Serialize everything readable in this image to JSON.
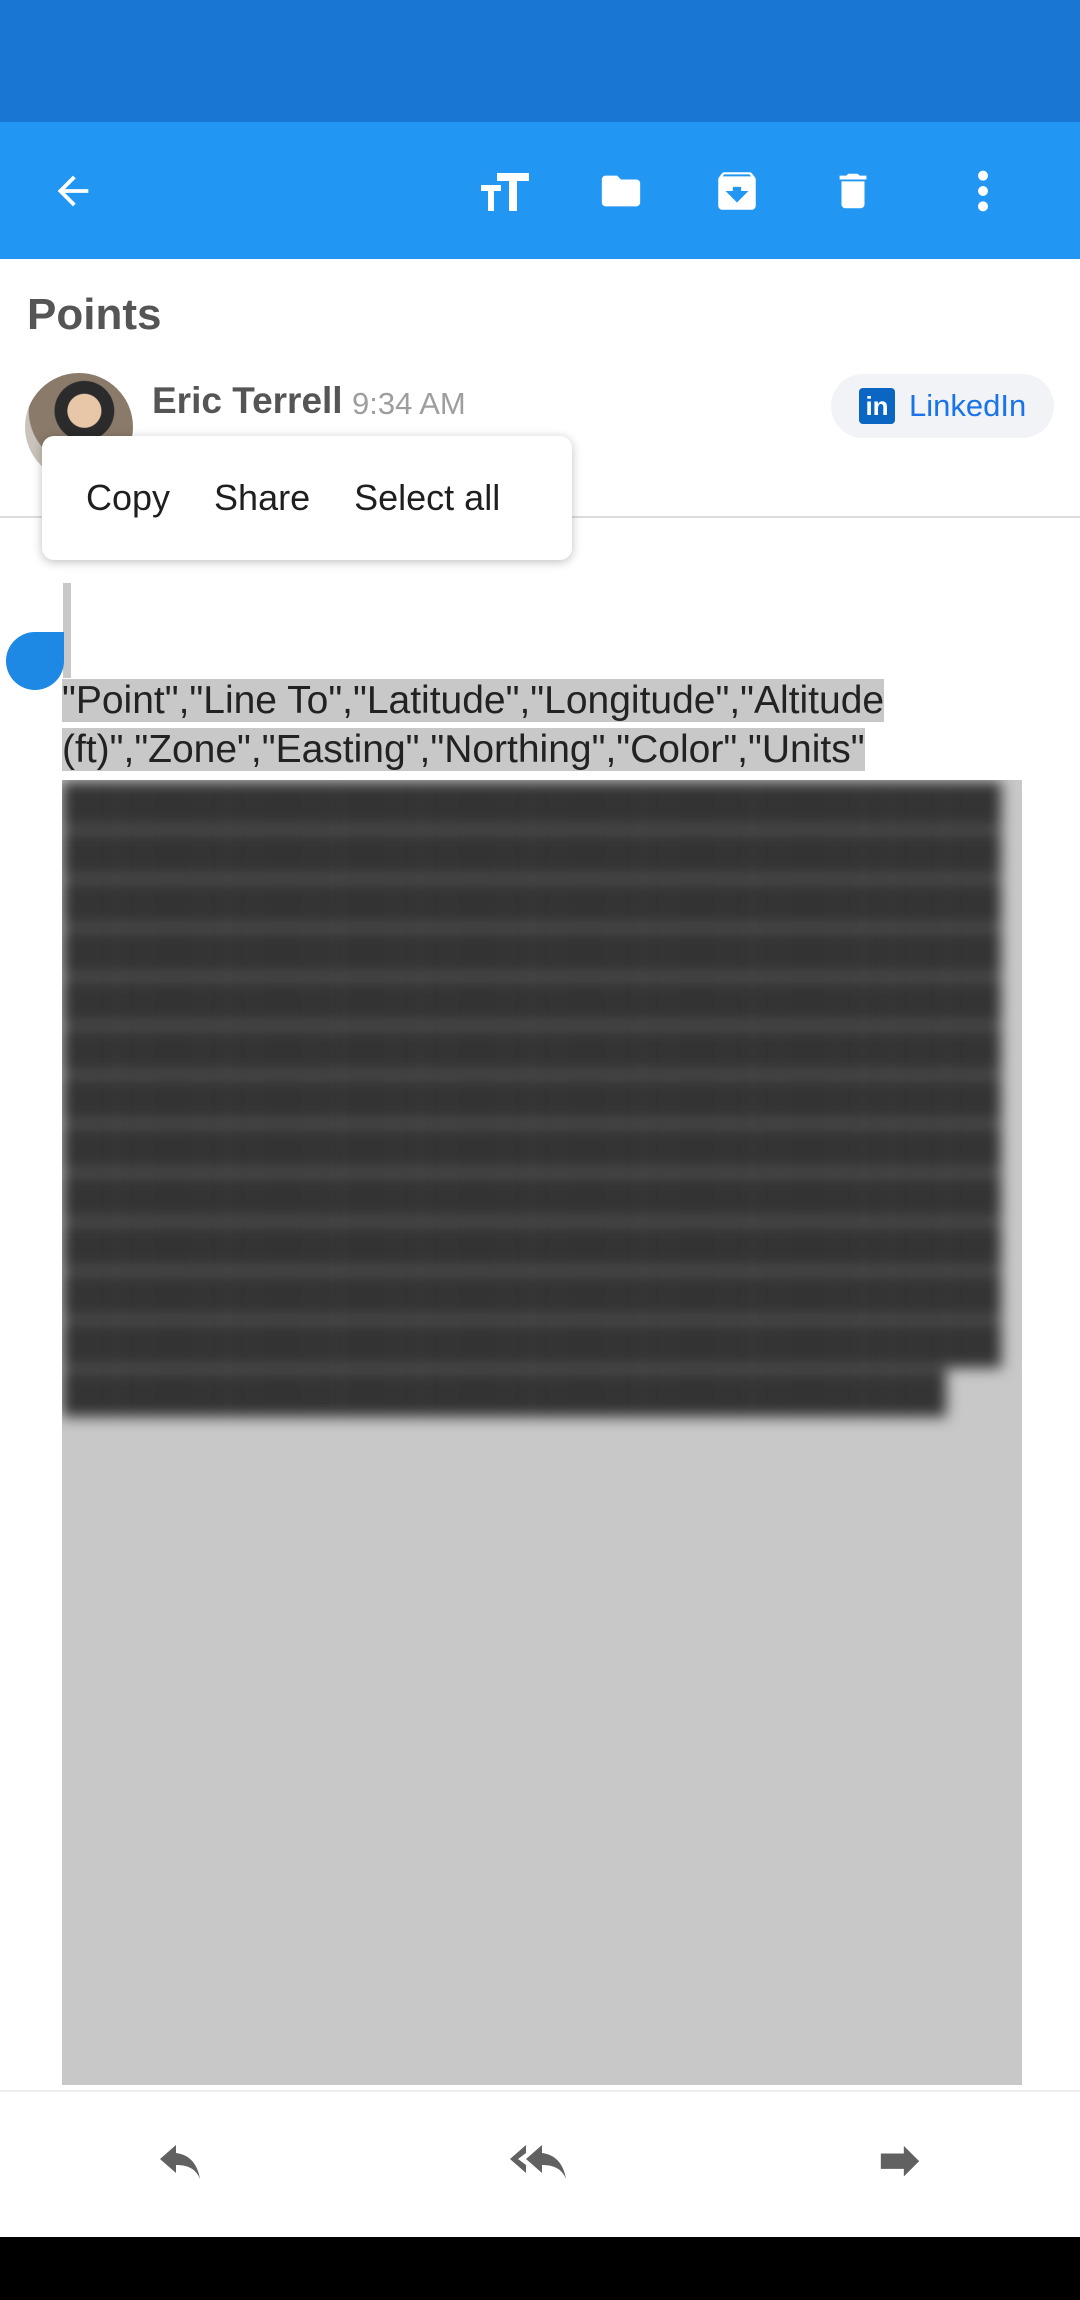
{
  "colors": {
    "status_bar": "#1976d2",
    "toolbar": "#2196f3",
    "accent": "#1e88e5",
    "selection": "#c8c8c8"
  },
  "toolbar": {
    "icons": [
      "back-arrow-icon",
      "text-size-icon",
      "folder-icon",
      "archive-icon",
      "trash-icon",
      "more-vert-icon"
    ]
  },
  "email": {
    "subject": "Points",
    "sender": "Eric Terrell",
    "time": "9:34 AM",
    "linkedin_label": "LinkedIn",
    "body_first_line": "\"Point\",\"Line To\",\"Latitude\",\"Longitude\",\"Altitude (ft)\",\"Zone\",\"Easting\",\"Northing\",\"Color\",\"Units\""
  },
  "context_menu": {
    "copy": "Copy",
    "share": "Share",
    "select_all": "Select all"
  },
  "bottom_actions": {
    "icons": [
      "reply-icon",
      "reply-all-icon",
      "forward-icon"
    ]
  }
}
